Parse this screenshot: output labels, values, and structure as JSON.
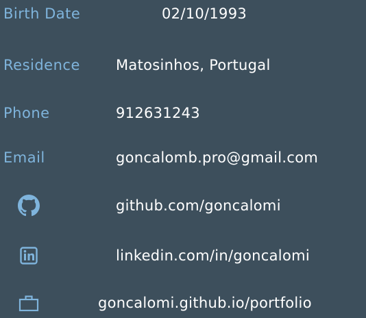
{
  "profile": {
    "birth_date": {
      "label": "Birth Date",
      "value": "02/10/1993"
    },
    "residence": {
      "label": "Residence",
      "value": "Matosinhos, Portugal"
    },
    "phone": {
      "label": "Phone",
      "value": "912631243"
    },
    "email": {
      "label": "Email",
      "value": "goncalomb.pro@gmail.com"
    }
  },
  "links": {
    "github": {
      "icon": "github-icon",
      "text": "github.com/goncalomi"
    },
    "linkedin": {
      "icon": "linkedin-icon",
      "text": "linkedin.com/in/goncalomi"
    },
    "portfolio": {
      "icon": "briefcase-icon",
      "text": "goncalomi.github.io/portfolio"
    }
  },
  "colors": {
    "background": "#3d4f5c",
    "label": "#7fb4dc",
    "value": "#ffffff"
  }
}
